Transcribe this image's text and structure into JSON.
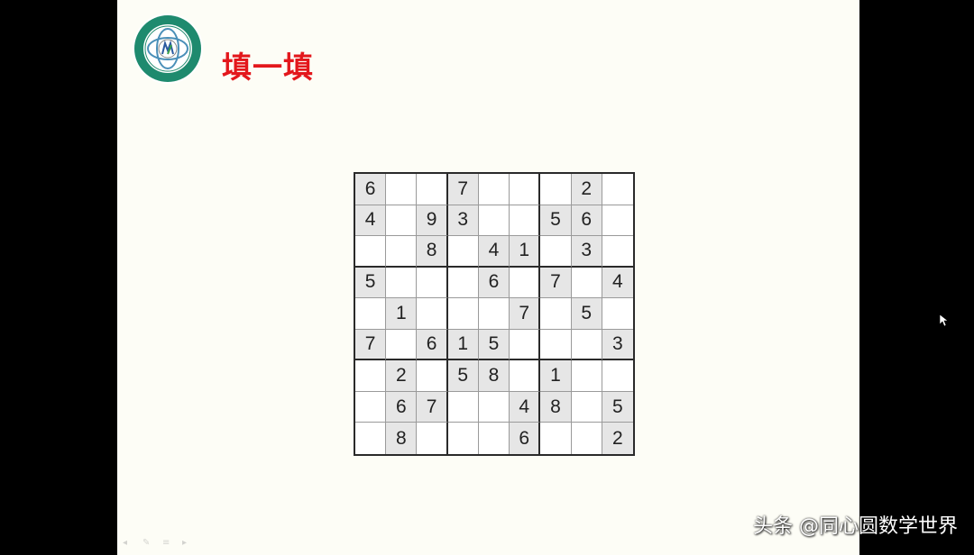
{
  "slide": {
    "title": "填一填"
  },
  "sudoku": {
    "rows": [
      [
        "6",
        "",
        "",
        "7",
        "",
        "",
        "",
        "2",
        ""
      ],
      [
        "4",
        "",
        "9",
        "3",
        "",
        "",
        "5",
        "6",
        ""
      ],
      [
        "",
        "",
        "8",
        "",
        "4",
        "1",
        "",
        "3",
        ""
      ],
      [
        "5",
        "",
        "",
        "",
        "6",
        "",
        "7",
        "",
        "4"
      ],
      [
        "",
        "1",
        "",
        "",
        "",
        "7",
        "",
        "5",
        ""
      ],
      [
        "7",
        "",
        "6",
        "1",
        "5",
        "",
        "",
        "",
        "3"
      ],
      [
        "",
        "2",
        "",
        "5",
        "8",
        "",
        "1",
        "",
        ""
      ],
      [
        "",
        "6",
        "7",
        "",
        "",
        "4",
        "8",
        "",
        "5"
      ],
      [
        "",
        "8",
        "",
        "",
        "",
        "6",
        "",
        "",
        "2"
      ]
    ]
  },
  "watermark": {
    "text": "头条 @同心圆数学世界"
  },
  "colors": {
    "title": "#e3171c",
    "slide_background": "#fdfdf6",
    "given_cell": "#e6e6e6"
  },
  "icons": {
    "logo": "school-emblem-icon",
    "cursor": "mouse-pointer-icon"
  }
}
